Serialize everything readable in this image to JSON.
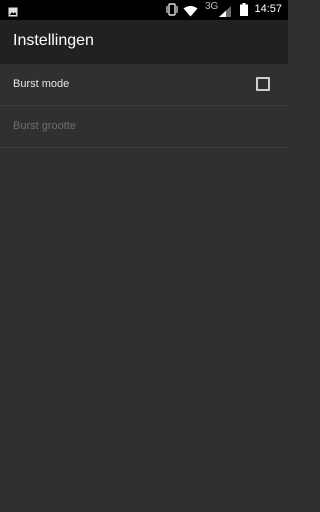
{
  "status_bar": {
    "time": "14:57",
    "network_type": "3G",
    "icons": [
      "image-notification-icon",
      "vibrate-icon",
      "wifi-icon",
      "signal-icon",
      "battery-icon"
    ]
  },
  "app_bar": {
    "title": "Instellingen"
  },
  "preferences": [
    {
      "label": "Burst mode",
      "type": "checkbox",
      "checked": false,
      "enabled": true
    },
    {
      "label": "Burst grootte",
      "type": "text",
      "enabled": false
    }
  ],
  "colors": {
    "background": "#303030",
    "app_bar": "#212121",
    "status_bar": "#000000",
    "divider": "#3c3c3c",
    "text_primary": "#e8e8e8",
    "text_disabled": "#6e6e6e"
  }
}
